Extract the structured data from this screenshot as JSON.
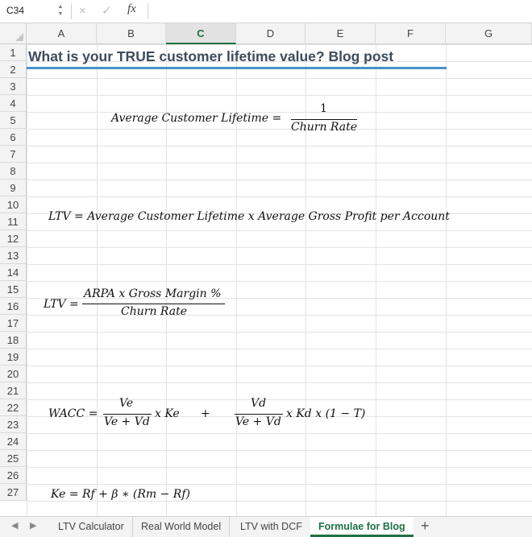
{
  "formula_bar": {
    "name_box": "C34",
    "cancel_icon": "×",
    "confirm_icon": "✓",
    "fx_label": "fx",
    "formula": ""
  },
  "columns": [
    "A",
    "B",
    "C",
    "D",
    "E",
    "F",
    "G"
  ],
  "selected_column": "C",
  "rows": [
    "1",
    "2",
    "3",
    "4",
    "5",
    "6",
    "7",
    "8",
    "9",
    "10",
    "11",
    "12",
    "13",
    "14",
    "15",
    "16",
    "17",
    "18",
    "19",
    "20",
    "21",
    "22",
    "23",
    "24",
    "25",
    "26",
    "27"
  ],
  "title": "What is your TRUE customer lifetime value? Blog post",
  "formulas": {
    "lifetime": {
      "lhs": "Average Customer Lifetime =",
      "numerator": "1",
      "denominator": "Churn Rate"
    },
    "ltv1": "LTV = Average Customer Lifetime x Average Gross Profit per Account",
    "ltv2": {
      "lhs": "LTV =",
      "numerator": "ARPA x Gross Margin %",
      "denominator": "Churn Rate"
    },
    "wacc": {
      "lhs": "WACC =",
      "num1": "Ve",
      "den1": "Ve + Vd",
      "mult1": "x Ke",
      "plus": "+",
      "num2": "Vd",
      "den2": "Ve + Vd",
      "mult2": "x Kd x (1 − T)"
    },
    "ke": "Ke =  Rf + β ∗ (Rm − Rf)"
  },
  "sheet_tabs": [
    "LTV Calculator",
    "Real World Model",
    "LTV with DCF",
    "Formulae for Blog"
  ],
  "active_tab": "Formulae for Blog",
  "add_sheet": "+"
}
